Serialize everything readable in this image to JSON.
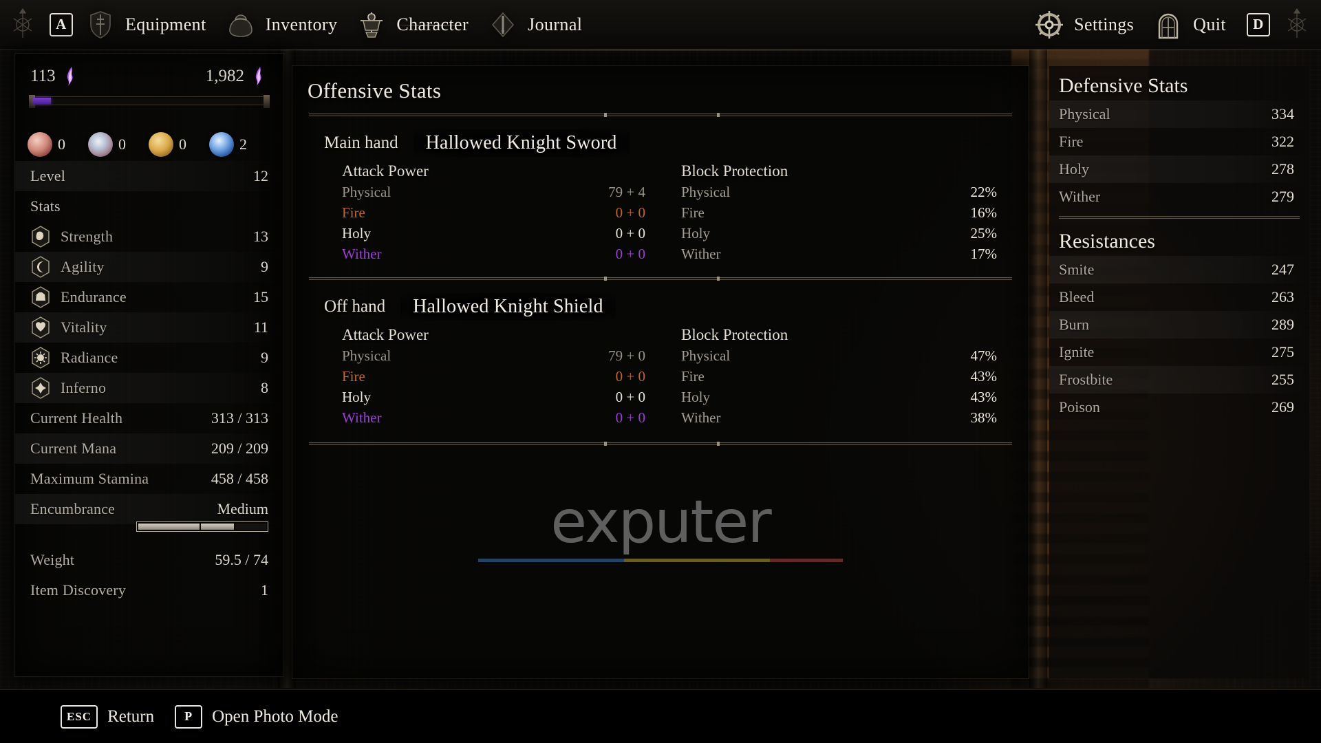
{
  "nav": {
    "left_keycap": "A",
    "right_keycap": "D",
    "items": [
      {
        "label": "Equipment",
        "icon": "shield-sword-icon",
        "active": false
      },
      {
        "label": "Inventory",
        "icon": "pouch-icon",
        "active": false
      },
      {
        "label": "Character",
        "icon": "armor-stand-icon",
        "active": true
      },
      {
        "label": "Journal",
        "icon": "journal-crest-icon",
        "active": false
      }
    ],
    "right_items": [
      {
        "label": "Settings",
        "icon": "gear-icon"
      },
      {
        "label": "Quit",
        "icon": "doorway-icon"
      }
    ]
  },
  "left_panel": {
    "xp_current": "113",
    "xp_total": "1,982",
    "xp_bar_percent": 7.5,
    "consumables": [
      {
        "icon": "bloody-hand-icon",
        "count": "0"
      },
      {
        "icon": "eyeball-icon",
        "count": "0"
      },
      {
        "icon": "gold-nugget-icon",
        "count": "0"
      },
      {
        "icon": "blue-orb-icon",
        "count": "2"
      }
    ],
    "level_label": "Level",
    "level_value": "12",
    "stats_header": "Stats",
    "attributes": [
      {
        "icon": "strength-icon",
        "label": "Strength",
        "value": "13"
      },
      {
        "icon": "agility-icon",
        "label": "Agility",
        "value": "9"
      },
      {
        "icon": "endurance-icon",
        "label": "Endurance",
        "value": "15"
      },
      {
        "icon": "vitality-icon",
        "label": "Vitality",
        "value": "11"
      },
      {
        "icon": "radiance-icon",
        "label": "Radiance",
        "value": "9"
      },
      {
        "icon": "inferno-icon",
        "label": "Inferno",
        "value": "8"
      }
    ],
    "vitals": [
      {
        "label": "Current Health",
        "value": "313 / 313"
      },
      {
        "label": "Current Mana",
        "value": "209 / 209"
      },
      {
        "label": "Maximum Stamina",
        "value": "458 / 458"
      },
      {
        "label": "Encumbrance",
        "value": "Medium"
      },
      {
        "label": "Weight",
        "value": "59.5 / 74"
      },
      {
        "label": "Item Discovery",
        "value": "1"
      }
    ]
  },
  "center_panel": {
    "title": "Offensive Stats",
    "attack_power_header": "Attack Power",
    "block_protection_header": "Block Protection",
    "hands": [
      {
        "kind": "Main hand",
        "weapon": "Hallowed Knight Sword",
        "attack": [
          {
            "type": "Physical",
            "value": "79 + 4",
            "color": "#9a948a"
          },
          {
            "type": "Fire",
            "value": "0 + 0",
            "color": "#c2652c"
          },
          {
            "type": "Holy",
            "value": "0 + 0",
            "color": "#e9e4d8"
          },
          {
            "type": "Wither",
            "value": "0 + 0",
            "color": "#9b3fd4"
          }
        ],
        "block": [
          {
            "type": "Physical",
            "value": "22%"
          },
          {
            "type": "Fire",
            "value": "16%"
          },
          {
            "type": "Holy",
            "value": "25%"
          },
          {
            "type": "Wither",
            "value": "17%"
          }
        ]
      },
      {
        "kind": "Off hand",
        "weapon": "Hallowed Knight Shield",
        "attack": [
          {
            "type": "Physical",
            "value": "79 + 0",
            "color": "#9a948a"
          },
          {
            "type": "Fire",
            "value": "0 + 0",
            "color": "#c2652c"
          },
          {
            "type": "Holy",
            "value": "0 + 0",
            "color": "#e9e4d8"
          },
          {
            "type": "Wither",
            "value": "0 + 0",
            "color": "#9b3fd4"
          }
        ],
        "block": [
          {
            "type": "Physical",
            "value": "47%"
          },
          {
            "type": "Fire",
            "value": "43%"
          },
          {
            "type": "Holy",
            "value": "43%"
          },
          {
            "type": "Wither",
            "value": "38%"
          }
        ]
      }
    ],
    "watermark": "exputer",
    "watermark_underline_colors": [
      "#3f7fc4",
      "#3f7fc4",
      "#c9b43a",
      "#c9b43a",
      "#b8504a"
    ]
  },
  "right_panel": {
    "defensive_title": "Defensive Stats",
    "defensive": [
      {
        "label": "Physical",
        "value": "334"
      },
      {
        "label": "Fire",
        "value": "322"
      },
      {
        "label": "Holy",
        "value": "278"
      },
      {
        "label": "Wither",
        "value": "279"
      }
    ],
    "resistances_title": "Resistances",
    "resistances": [
      {
        "label": "Smite",
        "value": "247"
      },
      {
        "label": "Bleed",
        "value": "263"
      },
      {
        "label": "Burn",
        "value": "289"
      },
      {
        "label": "Ignite",
        "value": "275"
      },
      {
        "label": "Frostbite",
        "value": "255"
      },
      {
        "label": "Poison",
        "value": "269"
      }
    ]
  },
  "bottom_bar": {
    "hints": [
      {
        "key": "ESC",
        "label": "Return"
      },
      {
        "key": "P",
        "label": "Open Photo Mode"
      }
    ]
  },
  "colors": {
    "accent_wither": "#9b3fd4",
    "accent_fire": "#c2652c",
    "xp_bar": "#6a33c2",
    "panel_bg": "#080706",
    "text_primary": "#e4ded2",
    "text_muted": "#b0a99d"
  }
}
